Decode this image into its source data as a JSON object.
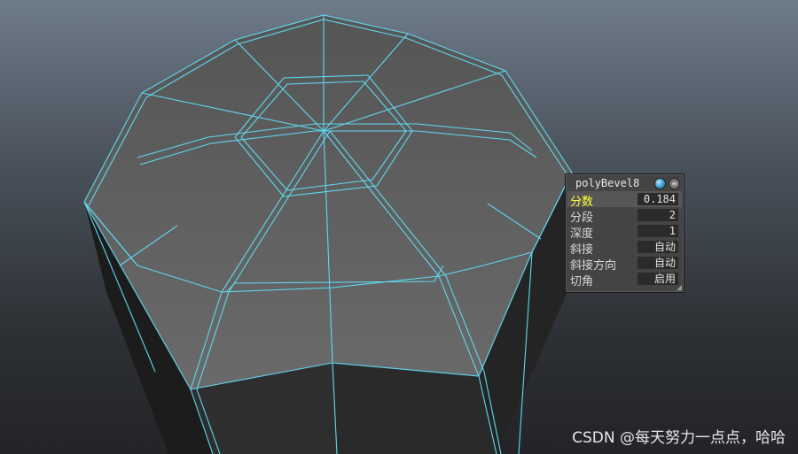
{
  "panel": {
    "title": "polyBevel8",
    "globe_icon": "globe-icon",
    "menu_icon": "options-icon",
    "rows": [
      {
        "label": "分数",
        "value": "0.184",
        "selected": true
      },
      {
        "label": "分段",
        "value": "2"
      },
      {
        "label": "深度",
        "value": "1"
      },
      {
        "label": "斜接",
        "value": "自动"
      },
      {
        "label": "斜接方向",
        "value": "自动"
      },
      {
        "label": "切角",
        "value": "启用"
      }
    ]
  },
  "watermark": "CSDN @每天努力一点点，哈哈",
  "colors": {
    "wireframe": "#5fd8f0",
    "highlight_label": "#ffff33"
  }
}
